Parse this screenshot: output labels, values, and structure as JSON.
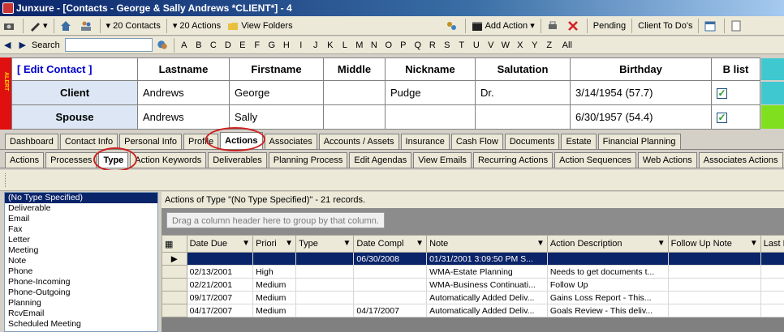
{
  "window": {
    "title": "Junxure - [Contacts - George & Sally Andrews *CLIENT*] - 4"
  },
  "toolbar": {
    "contacts_label": "20 Contacts",
    "actions_label": "20 Actions",
    "view_folders_label": "View Folders",
    "add_action_label": "Add Action",
    "pending_label": "Pending",
    "client_todos_label": "Client To Do's"
  },
  "alphabar": {
    "search_label": "Search",
    "letters": [
      "A",
      "B",
      "C",
      "D",
      "E",
      "F",
      "G",
      "H",
      "I",
      "J",
      "K",
      "L",
      "M",
      "N",
      "O",
      "P",
      "Q",
      "R",
      "S",
      "T",
      "U",
      "V",
      "W",
      "X",
      "Y",
      "Z",
      "All"
    ]
  },
  "contact": {
    "alert_text": "ALERT",
    "edit_label": "[ Edit Contact ]",
    "headers": [
      "Lastname",
      "Firstname",
      "Middle",
      "Nickname",
      "Salutation",
      "Birthday",
      "B list"
    ],
    "rows": [
      {
        "role": "Client",
        "lastname": "Andrews",
        "firstname": "George",
        "middle": "",
        "nickname": "Pudge",
        "salutation": "Dr.",
        "birthday": "3/14/1954 (57.7)",
        "blist": "✓",
        "color": "#40c8d0"
      },
      {
        "role": "Spouse",
        "lastname": "Andrews",
        "firstname": "Sally",
        "middle": "",
        "nickname": "",
        "salutation": "",
        "birthday": "6/30/1957 (54.4)",
        "blist": "✓",
        "color": "#80e020"
      }
    ]
  },
  "main_tabs": [
    "Dashboard",
    "Contact Info",
    "Personal Info",
    "Profile",
    "Actions",
    "Associates",
    "Accounts / Assets",
    "Insurance",
    "Cash Flow",
    "Documents",
    "Estate",
    "Financial Planning"
  ],
  "sub_tabs": [
    "Actions",
    "Processes",
    "Type",
    "Action Keywords",
    "Deliverables",
    "Planning Process",
    "Edit Agendas",
    "View Emails",
    "Recurring Actions",
    "Action Sequences",
    "Web Actions",
    "Associates Actions"
  ],
  "types": [
    "(No Type Specified)",
    "Deliverable",
    "Email",
    "Fax",
    "Letter",
    "Meeting",
    "Note",
    "Phone",
    "Phone-Incoming",
    "Phone-Outgoing",
    "Planning",
    "RcvEmail",
    "Scheduled Meeting"
  ],
  "grid": {
    "caption": "Actions of Type \"(No Type Specified)\" - 21 records.",
    "group_hint": "Drag a column header here to group by that column.",
    "columns": [
      "Date Due",
      "Priori",
      "Type",
      "Date Compl",
      "Note",
      "Action Description",
      "Follow Up Note",
      "Last Em"
    ],
    "rows": [
      [
        "",
        "",
        "",
        "06/30/2008",
        "01/31/2001 3:09:50 PM S...",
        "",
        "",
        ""
      ],
      [
        "02/13/2001",
        "High",
        "",
        "",
        "WMA-Estate Planning",
        "Needs to get documents t...",
        "",
        ""
      ],
      [
        "02/21/2001",
        "Medium",
        "",
        "",
        "WMA-Business Continuati...",
        "Follow Up",
        "",
        ""
      ],
      [
        "09/17/2007",
        "Medium",
        "",
        "",
        "Automatically Added Deliv...",
        "Gains Loss Report - This...",
        "",
        ""
      ],
      [
        "04/17/2007",
        "Medium",
        "",
        "04/17/2007",
        "Automatically Added Deliv...",
        "Goals Review - This deliv...",
        "",
        ""
      ]
    ]
  }
}
